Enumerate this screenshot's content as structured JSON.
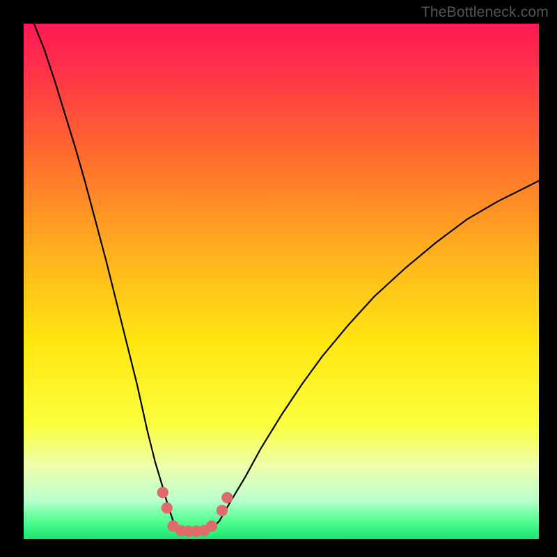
{
  "attribution": "TheBottleneck.com",
  "chart_data": {
    "type": "line",
    "title": "",
    "xlabel": "",
    "ylabel": "",
    "xlim": [
      0,
      100
    ],
    "ylim": [
      0,
      100
    ],
    "gradient_stops": [
      {
        "offset": 0,
        "color": "#ff1a55"
      },
      {
        "offset": 0.08,
        "color": "#ff2e4a"
      },
      {
        "offset": 0.25,
        "color": "#ff6a2f"
      },
      {
        "offset": 0.45,
        "color": "#ffb21e"
      },
      {
        "offset": 0.62,
        "color": "#ffe710"
      },
      {
        "offset": 0.78,
        "color": "#fbff40"
      },
      {
        "offset": 0.86,
        "color": "#edffad"
      },
      {
        "offset": 0.925,
        "color": "#b8ffce"
      },
      {
        "offset": 0.96,
        "color": "#5fff9a"
      },
      {
        "offset": 1,
        "color": "#17e86e"
      }
    ],
    "series": [
      {
        "name": "left-branch",
        "stroke": "#000000",
        "stroke_width": 2.2,
        "x": [
          2,
          4,
          6,
          8,
          10,
          12,
          14,
          16,
          18,
          20,
          22,
          24,
          25.5,
          27,
          28,
          29,
          30
        ],
        "y": [
          100,
          95,
          89,
          82.5,
          76,
          69,
          61.5,
          54,
          46,
          38,
          30,
          21,
          15,
          10,
          6.5,
          3.5,
          1.5
        ]
      },
      {
        "name": "right-branch",
        "stroke": "#000000",
        "stroke_width": 2.2,
        "x": [
          36,
          38,
          40,
          43,
          46,
          50,
          54,
          58,
          63,
          68,
          74,
          80,
          86,
          92,
          98,
          100
        ],
        "y": [
          1.5,
          3.5,
          7,
          12,
          17.5,
          24,
          30,
          35.5,
          41.5,
          47,
          52.5,
          57.5,
          62,
          65.5,
          68.5,
          69.5
        ]
      }
    ],
    "flat_bottom": {
      "stroke": "#000000",
      "stroke_width": 2.2,
      "x0": 30,
      "x1": 36,
      "y": 1.5
    },
    "markers": {
      "color": "#e06b6b",
      "radius_pct": 1.1,
      "points": [
        {
          "x": 27.0,
          "y": 9.0
        },
        {
          "x": 27.8,
          "y": 6.0
        },
        {
          "x": 29.0,
          "y": 2.5
        },
        {
          "x": 30.5,
          "y": 1.6
        },
        {
          "x": 32.0,
          "y": 1.5
        },
        {
          "x": 33.5,
          "y": 1.5
        },
        {
          "x": 35.0,
          "y": 1.6
        },
        {
          "x": 36.5,
          "y": 2.5
        },
        {
          "x": 38.5,
          "y": 5.5
        },
        {
          "x": 39.5,
          "y": 8.0
        }
      ]
    }
  }
}
